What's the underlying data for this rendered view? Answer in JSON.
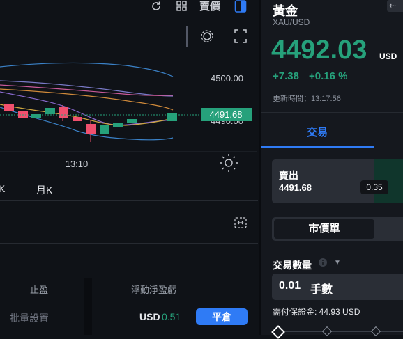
{
  "toolbar": {
    "refresh_icon": "refresh-icon",
    "grid_icon": "grid-icon",
    "sell_price_label": "賣價",
    "panel_icon": "panel-toggle-icon"
  },
  "chart": {
    "settings_icon": "gear-icon",
    "fullscreen_icon": "fullscreen-icon",
    "y_ticks": [
      "4500.00",
      "4490.00"
    ],
    "x_ticks": [
      "13:10"
    ],
    "current_price_label": "4491.68",
    "theme_icon": "sun-icon"
  },
  "chart_data": {
    "type": "candlestick",
    "y_axis_ticks": [
      4500.0,
      4490.0
    ],
    "x_axis_ticks": [
      "13:10"
    ],
    "current_price": 4491.68
  },
  "timeframes": [
    "K",
    "月K"
  ],
  "positions": {
    "expand_icon": "expand-icon",
    "headers": [
      "止盈",
      "浮動淨盈虧"
    ],
    "batch_settings_label": "批量設置",
    "pnl_currency": "USD",
    "pnl_value": "0.51",
    "close_button_label": "平倉"
  },
  "instrument": {
    "name": "黃金",
    "symbol": "XAU/USD",
    "price": "4492.03",
    "price_currency": "USD",
    "change_abs": "+7.38",
    "change_pct": "+0.16 %",
    "update_label": "更新時間：13:17:56"
  },
  "trade": {
    "tab_label": "交易",
    "sell_label": "賣出",
    "sell_price": "4491.68",
    "spread": "0.35",
    "order_type": "市價單",
    "quantity_label": "交易數量",
    "quantity_value": "0.01",
    "quantity_unit": "手數",
    "margin_label": "需付保證金: 44.93 USD"
  },
  "colors": {
    "up": "#26a17b",
    "down": "#f0506e",
    "accent": "#2f7bf5",
    "background": "#0f1217"
  }
}
